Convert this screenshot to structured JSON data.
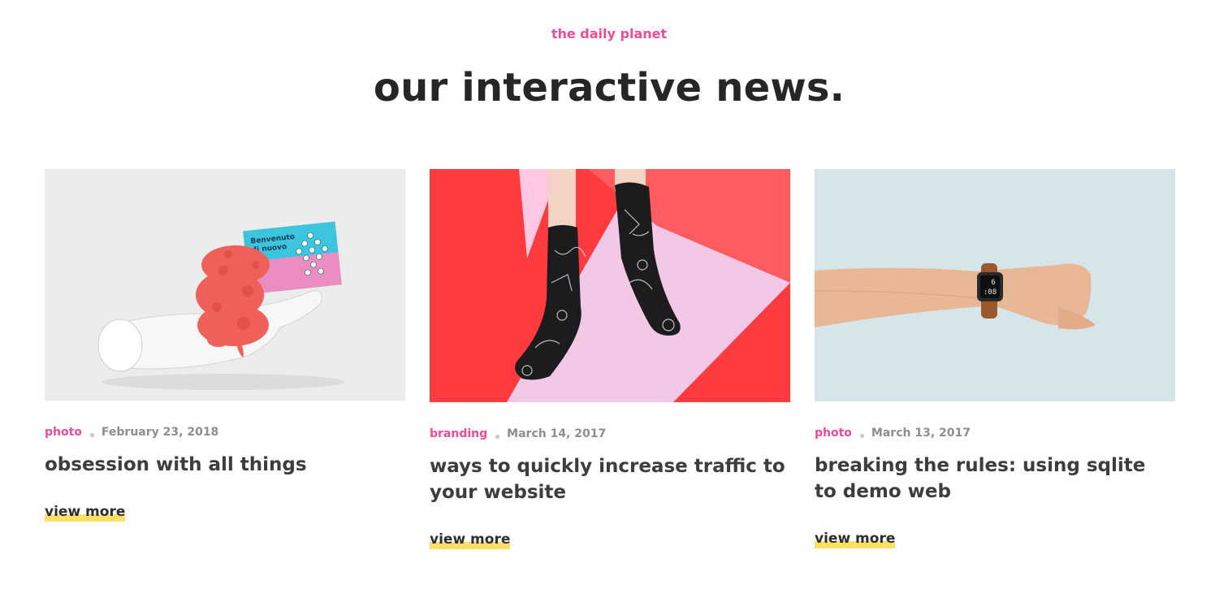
{
  "header": {
    "kicker": "the daily planet",
    "headline": "our interactive news."
  },
  "cards": [
    {
      "image_alt": "hand sculpture holding sorbet and card",
      "card_text_line1": "Benvenuto",
      "card_text_line2": "di nuovo",
      "category": "photo",
      "date": "February 23, 2018",
      "title": "obsession with all things",
      "cta": "view more"
    },
    {
      "image_alt": "legs in patterned black socks on pink and red background",
      "category": "branding",
      "date": "March 14, 2017",
      "title": "ways to quickly increase traffic to your website",
      "cta": "view more"
    },
    {
      "image_alt": "arm wearing a smartwatch on light blue background",
      "watch_line1": "6",
      "watch_line2": ":08",
      "category": "photo",
      "date": "March 13, 2017",
      "title": "breaking the rules: using sqlite to demo web",
      "cta": "view more"
    }
  ],
  "colors": {
    "accent": "#ee4a9a",
    "highlight": "#ffe066",
    "heading": "#262626"
  }
}
